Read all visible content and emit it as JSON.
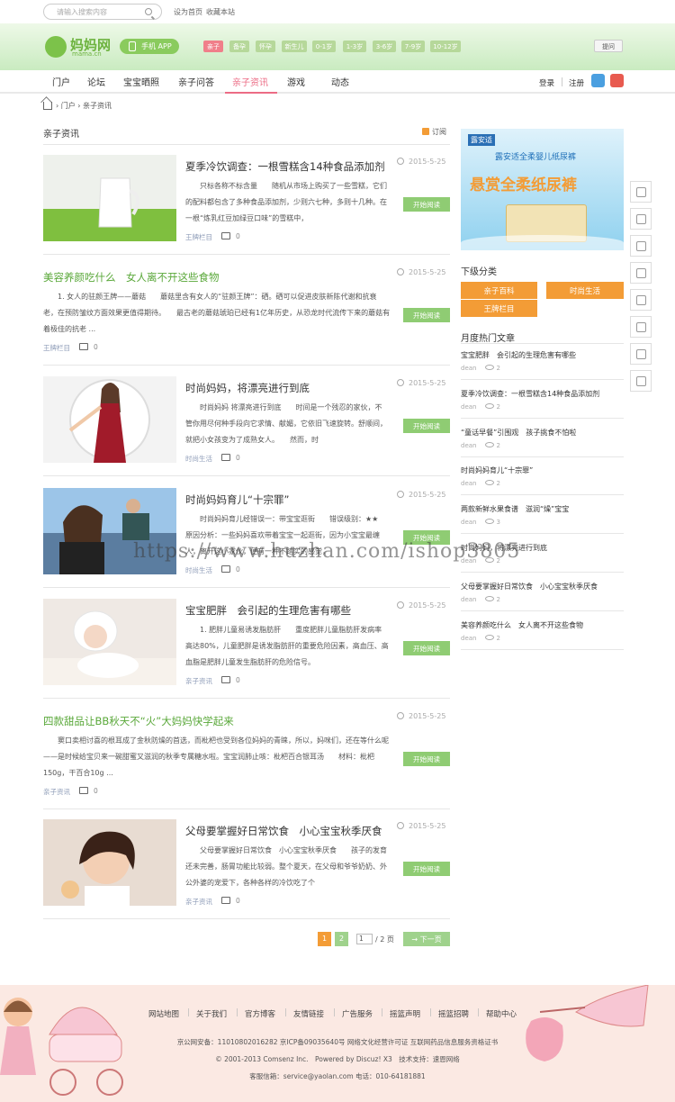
{
  "topbar": {
    "search_placeholder": "请输入搜索内容",
    "set_home": "设为首页",
    "bookmark": "收藏本站"
  },
  "header": {
    "logo_text": "妈妈网",
    "logo_sub": "mama.cn",
    "app_button": "手机 APP",
    "tags": [
      "亲子",
      "备孕",
      "怀孕",
      "新生儿",
      "0-1岁",
      "1-3岁",
      "3-6岁",
      "7-9岁",
      "10-12岁"
    ],
    "active_tag": "亲子",
    "ask_button": "提问"
  },
  "nav": {
    "items": [
      "门户",
      "论坛",
      "宝宝晒照",
      "亲子问答",
      "亲子资讯",
      "游戏",
      "动态"
    ],
    "active": "亲子资讯",
    "login": "登录",
    "register": "注册"
  },
  "breadcrumb": {
    "items": [
      "门户",
      "亲子资讯"
    ]
  },
  "section": {
    "title": "亲子资讯",
    "subscribe": "订阅"
  },
  "articles": [
    {
      "title": "夏季冷饮调查：一根雪糕含14种食品添加剂",
      "date": "2015-5-25",
      "summary": "只标各称不标含量　　随机从市场上购买了一些雪糕，它们的配料都包含了多种食品添加剂，少则六七种，多则十几种。在一根“炼乳红豆加绿豆口味”的雪糕中，",
      "category": "王牌栏目",
      "comments": "0",
      "button": "开始阅读",
      "image": "milk",
      "green": false
    },
    {
      "title": "美容养颜吃什么　女人离不开这些食物",
      "date": "2015-5-25",
      "summary": "1. 女人的驻颜王牌——蘑菇　　蘑菇里含有女人的“驻颜王牌”：硒。硒可以促进皮肤新陈代谢和抗衰老，在预防皱纹方面效果更值得期待。　　最古老的蘑菇琥珀已经有1亿年历史，从恐龙时代流传下来的蘑菇有着极佳的抗老 ...",
      "category": "王牌栏目",
      "comments": "0",
      "button": "开始阅读",
      "image": "",
      "green": true
    },
    {
      "title": "时尚妈妈，将漂亮进行到底",
      "date": "2015-5-25",
      "summary": "时尚妈妈 将漂亮进行到底　　时间是一个残忍的家伙，不管你用尽何种手段向它求情、献媚，它依旧飞速旋转。舒顺间，就把小女孩变为了成熟女人。　　然而，时",
      "category": "时尚生活",
      "comments": "0",
      "button": "开始阅读",
      "image": "woman-red",
      "green": false
    },
    {
      "title": "时尚妈妈育儿“十宗罪”",
      "date": "2015-5-25",
      "summary": "时尚妈妈育儿经错误一：带宝宝逛街　　错误级别：★★　　原因分析：一些妈妈喜欢带着宝宝一起逛街，因为小宝宝最缠人，离开这小家伙，便有一种不踏实的感觉，",
      "category": "时尚生活",
      "comments": "0",
      "button": "开始阅读",
      "image": "mom-beach",
      "green": false
    },
    {
      "title": "宝宝肥胖　会引起的生理危害有哪些",
      "date": "2015-5-25",
      "summary": "1. 肥胖儿童易诱发脂肪肝　　重度肥胖儿童脂肪肝发病率高达80%，儿童肥胖是诱发脂肪肝的重要危险因素，高血压、高血脂是肥胖儿童发生脂肪肝的危险信号。",
      "category": "亲子资讯",
      "comments": "0",
      "button": "开始阅读",
      "image": "baby",
      "green": false
    },
    {
      "title": "四款甜品让BB秋天不“火”大妈妈快学起来",
      "date": "2015-5-25",
      "summary": "窦口卖相讨喜的根耳成了金秋防燥的首选，而枇杷也受到各位妈妈的青睐，所以，妈咪们，还在等什么呢——是时候给宝贝来一碗甜蜜又滋润的秋季专属糖水啦。宝宝润肺止咳：枇杷百合银耳汤　　材料：枇杷150g，干百合10g ...",
      "category": "亲子资讯",
      "comments": "0",
      "button": "开始阅读",
      "image": "",
      "green": true
    },
    {
      "title": "父母要掌握好日常饮食　小心宝宝秋季厌食",
      "date": "2015-5-25",
      "summary": "父母要掌握好日常饮食　小心宝宝秋季厌食　　孩子的发育还未完善，肠胃功能比较弱。整个夏天，在父母和爷爷奶奶、外公外婆的宠爱下，各种各样的冷饮吃了个",
      "category": "亲子资讯",
      "comments": "0",
      "button": "开始阅读",
      "image": "woman-short",
      "green": false
    }
  ],
  "pager": {
    "pages": [
      "1",
      "2"
    ],
    "current": "1",
    "page_input": "1",
    "total": "/ 2 页",
    "next": "下一页"
  },
  "sidebar": {
    "ad": {
      "brand": "露安适",
      "headline": "悬赏全柔纸尿裤",
      "sub": "露安适全柔婴儿纸尿裤"
    },
    "subcat_title": "下级分类",
    "subcats": [
      "亲子百科",
      "时尚生活",
      "王牌栏目"
    ],
    "hot_title": "月度热门文章",
    "hot": [
      {
        "title": "宝宝肥胖　会引起的生理危害有哪些",
        "author": "dean",
        "views": "2"
      },
      {
        "title": "夏季冷饮调查：一根雪糕含14种食品添加剂",
        "author": "dean",
        "views": "2"
      },
      {
        "title": "“童话早餐”引围观　孩子挑食不怕啦",
        "author": "dean",
        "views": "2"
      },
      {
        "title": "时尚妈妈育儿“十宗罪”",
        "author": "dean",
        "views": "2"
      },
      {
        "title": "两款新鲜水果食谱　滋润“燥”宝宝",
        "author": "dean",
        "views": "3"
      },
      {
        "title": "时尚妈妈，将漂亮进行到底",
        "author": "dean",
        "views": "2"
      },
      {
        "title": "父母要掌握好日常饮食　小心宝宝秋季厌食",
        "author": "dean",
        "views": "2"
      },
      {
        "title": "美容养颜吃什么　女人离不开这些食物",
        "author": "dean",
        "views": "2"
      }
    ]
  },
  "watermark": "https://www.huzhan.com/ishop3805",
  "footer": {
    "links": [
      "网站地图",
      "关于我们",
      "官方博客",
      "友情链接",
      "广告服务",
      "摇篮声明",
      "摇篮招聘",
      "帮助中心"
    ],
    "icp": "京公网安备：11010802016282 京ICP备09035640号 网络文化经营许可证 互联网药品信息服务资格证书",
    "copyright": "© 2001-2013 Comsenz Inc.　Powered by Discuz! X3　技术支持：速恩网络",
    "contact": "客服信箱：service@yaolan.com 电话：010-64181881"
  },
  "colors": {
    "green": "#8fcc73",
    "pink": "#ec6c85",
    "orange": "#f39c36"
  }
}
